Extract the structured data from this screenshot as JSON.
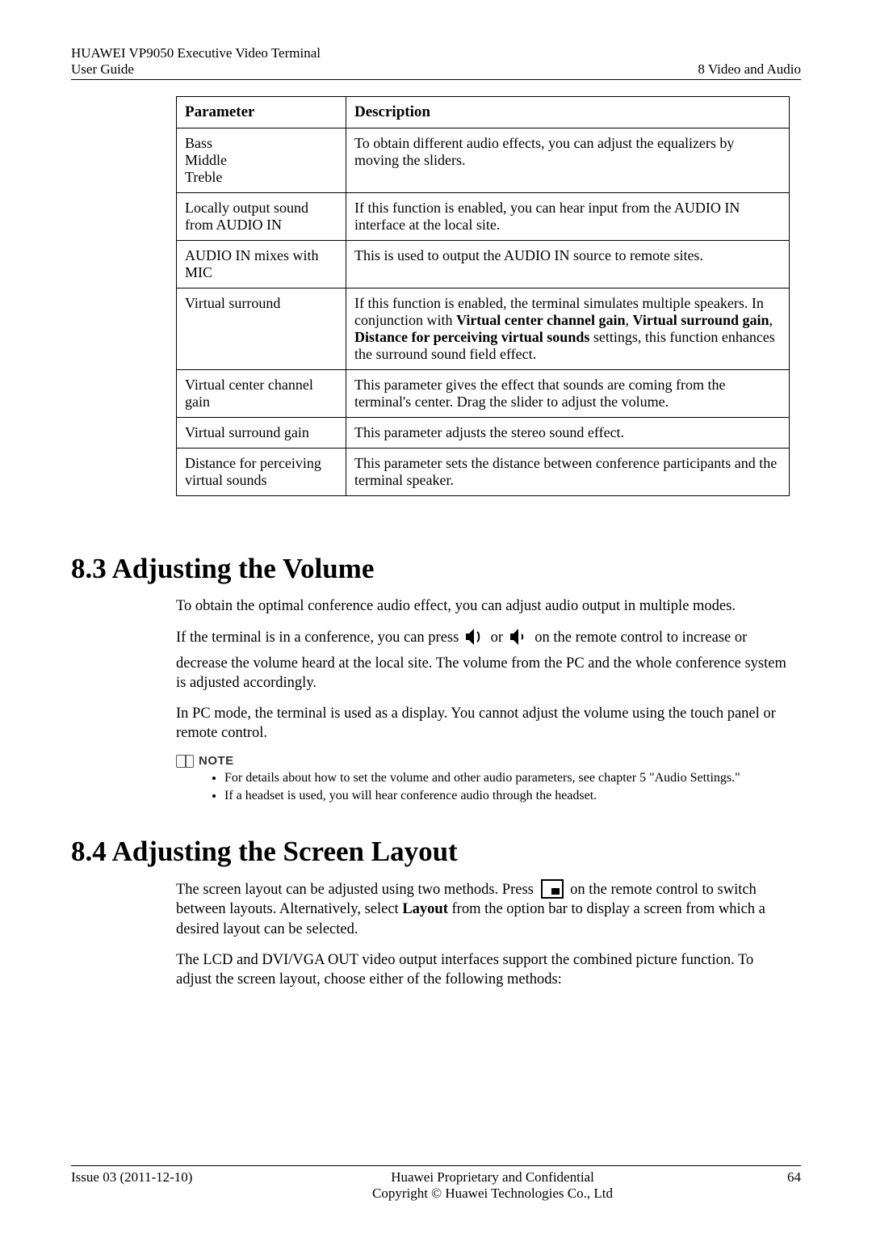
{
  "header": {
    "product": "HUAWEI VP9050 Executive Video Terminal",
    "doc": "User Guide",
    "chapter": "8 Video and Audio"
  },
  "table": {
    "col1": "Parameter",
    "col2": "Description",
    "rows": [
      {
        "param": "Bass\nMiddle\nTreble",
        "desc": "To obtain different audio effects, you can adjust the equalizers by moving the sliders."
      },
      {
        "param": "Locally output sound from AUDIO IN",
        "desc": "If this function is enabled, you can hear input from the AUDIO IN interface at the local site."
      },
      {
        "param": "AUDIO IN mixes with MIC",
        "desc": "This is used to output the AUDIO IN source to remote sites."
      },
      {
        "param": "Virtual surround",
        "desc_pre": "If this function is enabled, the terminal simulates multiple speakers. In conjunction with ",
        "desc_b1": "Virtual center channel gain",
        "desc_mid1": ", ",
        "desc_b2": "Virtual surround gain",
        "desc_mid2": ", ",
        "desc_b3": "Distance for perceiving virtual sounds",
        "desc_post": " settings, this function enhances the surround sound field effect."
      },
      {
        "param": "Virtual center channel gain",
        "desc": "This parameter gives the effect that sounds are coming from the terminal's center. Drag the slider to adjust the volume."
      },
      {
        "param": "Virtual surround gain",
        "desc": "This parameter adjusts the stereo sound effect."
      },
      {
        "param": "Distance for perceiving virtual sounds",
        "desc": "This parameter sets the distance between conference participants and the terminal speaker."
      }
    ]
  },
  "section_volume": {
    "heading": "8.3 Adjusting the Volume",
    "p1": "To obtain the optimal conference audio effect, you can adjust audio output in multiple modes.",
    "p2_pre": "If the terminal is in a conference, you can press ",
    "p2_mid": " or ",
    "p2_post": " on the remote control to increase or decrease the volume heard at the local site. The volume from the PC and the whole conference system is adjusted accordingly.",
    "p3": "In PC mode, the terminal is used as a display. You cannot adjust the volume using the touch panel or remote control."
  },
  "note": {
    "label": "NOTE",
    "items": [
      "For details about how to set the volume and other audio parameters, see chapter 5 \"Audio Settings.\"",
      "If a headset is used, you will hear conference audio through the headset."
    ]
  },
  "section_layout": {
    "heading": "8.4 Adjusting the Screen Layout",
    "p1_pre": "The screen layout can be adjusted using two methods. Press ",
    "p1_mid": " on the remote control to switch between layouts. Alternatively, select ",
    "p1_bold": "Layout",
    "p1_post": " from the option bar to display a screen from which a desired layout can be selected.",
    "p2": "The LCD and DVI/VGA OUT video output interfaces support the combined picture function. To adjust the screen layout, choose either of the following methods:"
  },
  "footer": {
    "issue": "Issue 03 (2011-12-10)",
    "center1": "Huawei Proprietary and Confidential",
    "center2": "Copyright © Huawei Technologies Co., Ltd",
    "page": "64"
  }
}
